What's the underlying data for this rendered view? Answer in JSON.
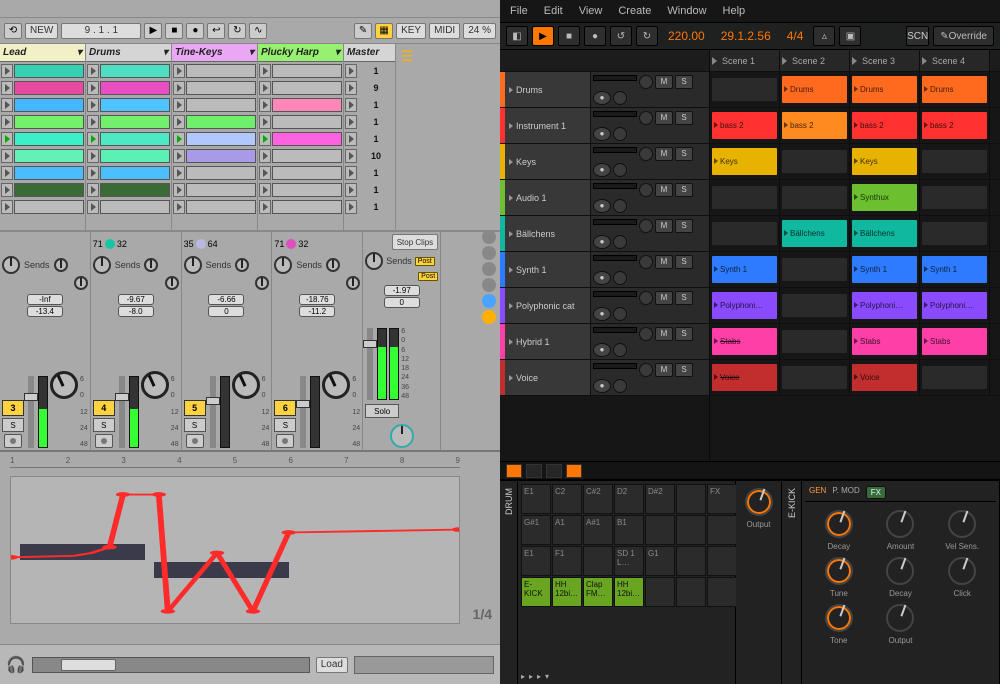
{
  "ableton": {
    "toolbar": {
      "new_label": "NEW",
      "counter": "9 . 1 . 1",
      "pencil_active": true,
      "key_label": "KEY",
      "midi_label": "MIDI",
      "midi_pct": "24 %"
    },
    "scene_numbers": [
      "1",
      "9",
      "1",
      "1",
      "1",
      "10",
      "1",
      "1",
      "1"
    ],
    "tracks": [
      {
        "name": "Lead",
        "color": "#f2f0c7",
        "clips": [
          "#38d0b4",
          "#e64b9f",
          "#44b7ff",
          "#75f06a",
          "#3bf0c7",
          "#63f2b5",
          "#49bdff",
          "#3a6a36",
          "#"
        ]
      },
      {
        "name": "Drums",
        "color": "#d5d5d5",
        "clips": [
          "#4edfc2",
          "#e84fc4",
          "#4fc3ff",
          "#72ef6c",
          "#4de9c5",
          "#5bf0b4",
          "#4cc0ff",
          "#3a6a36",
          "#"
        ]
      },
      {
        "name": "Tine-Keys",
        "color": "#e9a7f4",
        "clips": [
          "#",
          "#",
          "#",
          "#6ff06c",
          "#b1c8ff",
          "#a99ae8",
          "#",
          "#",
          "#"
        ]
      },
      {
        "name": "Plucky Harp",
        "color": "#97f06f",
        "clips": [
          "#",
          "#",
          "#ff87b7",
          "#",
          "#ff62e1",
          "#",
          "#",
          "#",
          "#"
        ]
      }
    ],
    "mixer": [
      {
        "n": "3",
        "n_color": "#ffd23f",
        "pan_top": "",
        "sends": "Sends",
        "db1": "-Inf",
        "db2": "-13.4",
        "meter": 0.55,
        "fader": 0.65
      },
      {
        "n": "4",
        "n_color": "#ffd23f",
        "pan_top": "71",
        "ball": "#17c6a1",
        "pan2": "32",
        "sends": "Sends",
        "db1": "-9.67",
        "db2": "-8.0",
        "meter": 0.55,
        "fader": 0.65
      },
      {
        "n": "5",
        "n_color": "#ffd23f",
        "pan_top": "35",
        "ball": "#b8b8e2",
        "pan2": "64",
        "sends": "Sends",
        "db1": "-6.66",
        "db2": "0",
        "meter": 0.0,
        "fader": 0.6
      },
      {
        "n": "6",
        "n_color": "#ffd23f",
        "pan_top": "71",
        "ball": "#e04fbf",
        "pan2": "32",
        "sends": "Sends",
        "db1": "-18.76",
        "db2": "-11.2",
        "meter": 0.0,
        "fader": 0.55
      }
    ],
    "master": {
      "stop": "Stop Clips",
      "post": "Post",
      "sends": "Sends",
      "db1": "-1.97",
      "db2": "0",
      "meter": 0.75,
      "fader": 0.72,
      "solo": "Solo",
      "scale": [
        "6",
        "0",
        "6",
        "12",
        "18",
        "24",
        "36",
        "48"
      ]
    },
    "automation": {
      "ruler": [
        "1",
        "2",
        "3",
        "4",
        "5",
        "6",
        "7",
        "8",
        "9"
      ],
      "fraction": "1/4",
      "load": "Load"
    },
    "side_dots": [
      "#888",
      "#888",
      "#888",
      "#888",
      "#4aa3ff",
      "#ffb000"
    ]
  },
  "bitwig": {
    "menu": [
      "File",
      "Edit",
      "View",
      "Create",
      "Window",
      "Help"
    ],
    "transport": {
      "tempo": "220.00",
      "position": "29.1.2.56",
      "timesig": "4/4",
      "override": "Override"
    },
    "scenes": [
      "Scene 1",
      "Scene 2",
      "Scene 3",
      "Scene 4"
    ],
    "tracks": [
      {
        "name": "Drums",
        "color": "#ff6a1f",
        "clips": [
          {
            "c": "",
            "t": ""
          },
          {
            "c": "#ff6a1f",
            "t": "Drums"
          },
          {
            "c": "#ff6a1f",
            "t": "Drums"
          },
          {
            "c": "#ff6a1f",
            "t": "Drums"
          }
        ]
      },
      {
        "name": "Instrument 1",
        "color": "#ff3131",
        "clips": [
          {
            "c": "#ff3131",
            "t": "bass 2"
          },
          {
            "c": "#ff8a1f",
            "t": "bass 2"
          },
          {
            "c": "#ff3131",
            "t": "bass 2"
          },
          {
            "c": "#ff3131",
            "t": "bass 2"
          }
        ]
      },
      {
        "name": "Keys",
        "color": "#e8b200",
        "clips": [
          {
            "c": "#e8b200",
            "t": "Keys"
          },
          {
            "c": "",
            "t": ""
          },
          {
            "c": "#e8b200",
            "t": "Keys"
          },
          {
            "c": "",
            "t": ""
          }
        ]
      },
      {
        "name": "Audio 1",
        "color": "#6cbf2e",
        "clips": [
          {
            "c": "",
            "t": ""
          },
          {
            "c": "",
            "t": ""
          },
          {
            "c": "#6cbf2e",
            "t": "Synthux",
            "wave": true
          },
          {
            "c": "",
            "t": ""
          }
        ]
      },
      {
        "name": "Bällchens",
        "color": "#10b8a0",
        "clips": [
          {
            "c": "",
            "t": ""
          },
          {
            "c": "#10b8a0",
            "t": "Bällchens"
          },
          {
            "c": "#10b8a0",
            "t": "Bällchens"
          },
          {
            "c": "",
            "t": ""
          }
        ]
      },
      {
        "name": "Synth 1",
        "color": "#2e7bff",
        "clips": [
          {
            "c": "#2e7bff",
            "t": "Synth 1"
          },
          {
            "c": "",
            "t": ""
          },
          {
            "c": "#2e7bff",
            "t": "Synth 1"
          },
          {
            "c": "#2e7bff",
            "t": "Synth 1"
          }
        ]
      },
      {
        "name": "Polyphonic cat",
        "color": "#8a4bff",
        "clips": [
          {
            "c": "#8a4bff",
            "t": "Polyphoni…"
          },
          {
            "c": "",
            "t": ""
          },
          {
            "c": "#8a4bff",
            "t": "Polyphoni…"
          },
          {
            "c": "#8a4bff",
            "t": "Polyphoni…"
          }
        ]
      },
      {
        "name": "Hybrid 1",
        "color": "#ff3fa8",
        "clips": [
          {
            "c": "#ff3fa8",
            "t": "Stabs",
            "strike": true
          },
          {
            "c": "",
            "t": ""
          },
          {
            "c": "#ff3fa8",
            "t": "Stabs"
          },
          {
            "c": "#ff3fa8",
            "t": "Stabs"
          }
        ]
      },
      {
        "name": "Voice",
        "color": "#c22e2e",
        "clips": [
          {
            "c": "#c22e2e",
            "t": "Voice",
            "strike": true
          },
          {
            "c": "",
            "t": ""
          },
          {
            "c": "#c22e2e",
            "t": "Voice"
          },
          {
            "c": "",
            "t": ""
          }
        ]
      }
    ],
    "drum": {
      "label": "DRUM",
      "rows": [
        [
          "E1",
          "C2",
          "C#2",
          "D2",
          "D#2",
          "",
          "FX"
        ],
        [
          "G#1",
          "A1",
          "A#1",
          "B1",
          "",
          "",
          ""
        ],
        [
          "E1",
          "F1",
          "",
          "SD 1 L…",
          "G1",
          "",
          ""
        ],
        [
          "E-KICK",
          "HH 12bi…",
          "Clap FM…",
          "HH 12bi…",
          "",
          "",
          ""
        ]
      ],
      "output": "Output"
    },
    "ekick": {
      "label": "E-KICK",
      "gen": "GEN",
      "pmod": "P. MOD",
      "fx": "FX",
      "params": [
        "Decay",
        "Amount",
        "Vel Sens.",
        "Tune",
        "Decay",
        "Click",
        "Tone",
        "Output"
      ]
    }
  }
}
